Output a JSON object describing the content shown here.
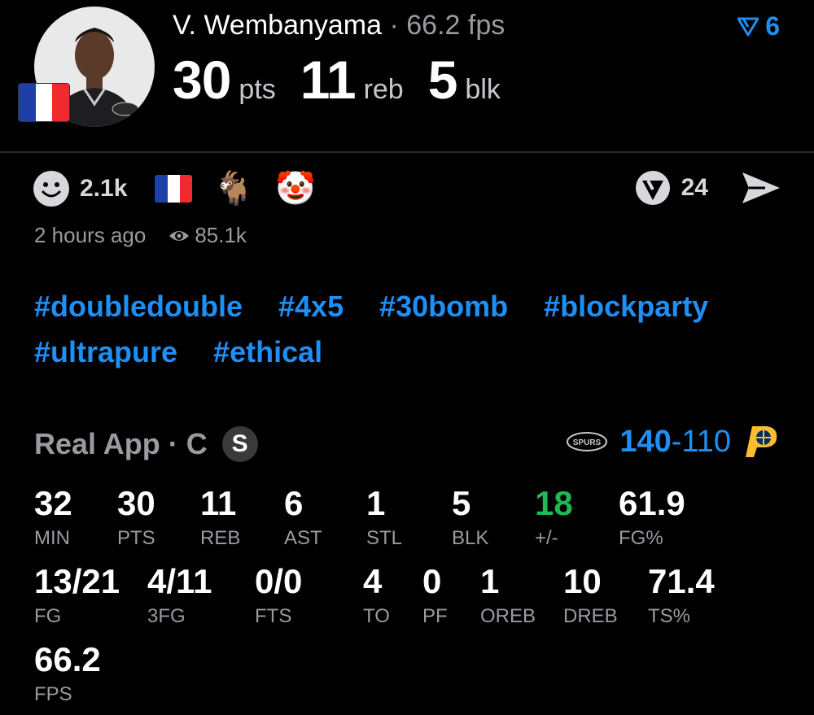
{
  "player": {
    "name": "V. Wembanyama",
    "separator": "·",
    "fps_header": "66.2 fps",
    "flag_colors": [
      "#1c3fa8",
      "#ffffff",
      "#ef2b2d"
    ]
  },
  "headline": [
    {
      "value": "30",
      "label": "pts"
    },
    {
      "value": "11",
      "label": "reb"
    },
    {
      "value": "5",
      "label": "blk"
    }
  ],
  "rank": {
    "value": "6",
    "icon": "rank-arrow-icon",
    "color": "#1e8ff5"
  },
  "reactions": {
    "smile_count": "2.1k",
    "emojis": [
      "🐐",
      "🤡"
    ],
    "comments": "24"
  },
  "meta": {
    "time": "2 hours ago",
    "views": "85.1k"
  },
  "hashtags": [
    "#doubledouble",
    "#4x5",
    "#30bomb",
    "#blockparty",
    "#ultrapure",
    "#ethical"
  ],
  "game": {
    "source": "Real App",
    "position": "C",
    "badge": "S",
    "team_score": "140",
    "dash": "-",
    "opp_score": "110",
    "team_logo_text": "SPURS"
  },
  "stats_row1": [
    {
      "value": "32",
      "label": "MIN"
    },
    {
      "value": "30",
      "label": "PTS"
    },
    {
      "value": "11",
      "label": "REB"
    },
    {
      "value": "6",
      "label": "AST"
    },
    {
      "value": "1",
      "label": "STL"
    },
    {
      "value": "5",
      "label": "BLK"
    },
    {
      "value": "18",
      "label": "+/-"
    },
    {
      "value": "61.9",
      "label": "FG%"
    }
  ],
  "stats_row2": [
    {
      "value": "13/21",
      "label": "FG"
    },
    {
      "value": "4/11",
      "label": "3FG"
    },
    {
      "value": "0/0",
      "label": "FTS"
    },
    {
      "value": "4",
      "label": "TO"
    },
    {
      "value": "0",
      "label": "PF"
    },
    {
      "value": "1",
      "label": "OREB"
    },
    {
      "value": "10",
      "label": "DREB"
    },
    {
      "value": "71.4",
      "label": "TS%"
    }
  ],
  "stats_row3": [
    {
      "value": "66.2",
      "label": "FPS"
    }
  ],
  "colors": {
    "accent": "#1e8ff5",
    "positive": "#1db954",
    "muted": "#9a9aa0"
  }
}
